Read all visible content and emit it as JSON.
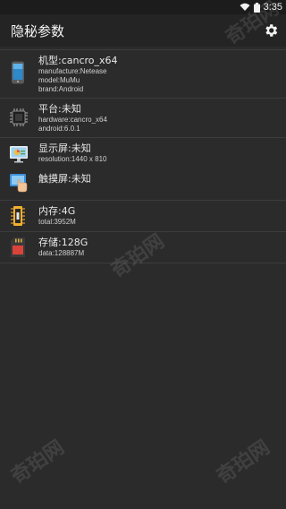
{
  "status_bar": {
    "time": "3:35"
  },
  "app_bar": {
    "title": "隐秘参数"
  },
  "items": [
    {
      "title": "机型:cancro_x64",
      "lines": [
        "manufacture:Netease",
        "model:MuMu",
        "brand:Android"
      ]
    },
    {
      "title": "平台:未知",
      "lines": [
        "hardware:cancro_x64",
        "android:6.0.1"
      ]
    },
    {
      "title": "显示屏:未知",
      "lines": [
        "resolution:1440 x 810"
      ]
    },
    {
      "title": "触摸屏:未知",
      "lines": []
    },
    {
      "title": "内存:4G",
      "lines": [
        "total:3952M"
      ]
    },
    {
      "title": "存储:128G",
      "lines": [
        "data:128887M"
      ]
    }
  ],
  "watermark": "奇珀网"
}
